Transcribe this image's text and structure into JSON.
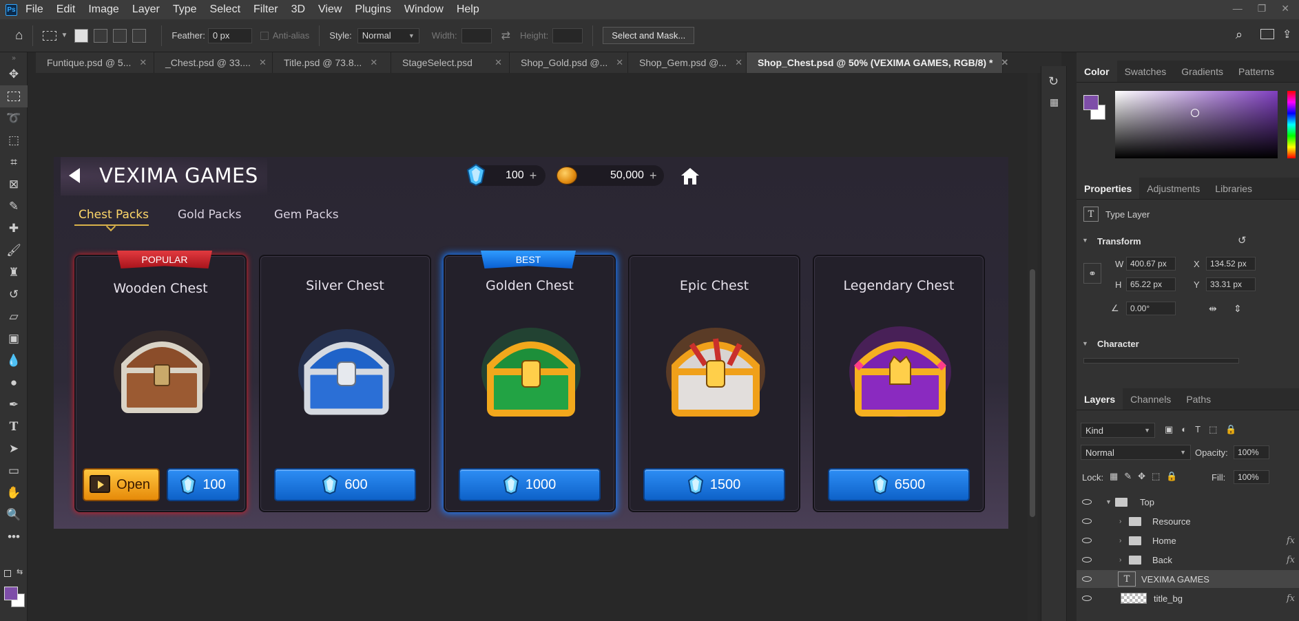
{
  "app": {
    "logo": "Ps",
    "menu": [
      "File",
      "Edit",
      "Image",
      "Layer",
      "Type",
      "Select",
      "Filter",
      "3D",
      "View",
      "Plugins",
      "Window",
      "Help"
    ]
  },
  "options": {
    "feather_label": "Feather:",
    "feather_value": "0 px",
    "anti_alias": "Anti-alias",
    "style_label": "Style:",
    "style_value": "Normal",
    "width_label": "Width:",
    "height_label": "Height:",
    "select_mask": "Select and Mask..."
  },
  "doc_tabs": [
    {
      "label": "Funtique.psd @ 5..."
    },
    {
      "label": "_Chest.psd @ 33...."
    },
    {
      "label": "Title.psd @ 73.8..."
    },
    {
      "label": "StageSelect.psd"
    },
    {
      "label": "Shop_Gold.psd @..."
    },
    {
      "label": "Shop_Gem.psd @..."
    },
    {
      "label": "Shop_Chest.psd @ 50% (VEXIMA GAMES, RGB/8) *"
    }
  ],
  "game": {
    "title": "VEXIMA GAMES",
    "gems": "100",
    "gold": "50,000",
    "plus": "+",
    "tabs": [
      "Chest Packs",
      "Gold Packs",
      "Gem Packs"
    ],
    "active_tab": "Chest Packs",
    "open_label": "Open",
    "cards": [
      {
        "name": "Wooden Chest",
        "badge": "POPULAR",
        "price": "100",
        "has_open": true
      },
      {
        "name": "Silver Chest",
        "badge": "",
        "price": "600",
        "has_open": false
      },
      {
        "name": "Golden Chest",
        "badge": "BEST",
        "price": "1000",
        "has_open": false
      },
      {
        "name": "Epic Chest",
        "badge": "",
        "price": "1500",
        "has_open": false
      },
      {
        "name": "Legendary Chest",
        "badge": "",
        "price": "6500",
        "has_open": false
      }
    ]
  },
  "color_panel": {
    "tabs": [
      "Color",
      "Swatches",
      "Gradients",
      "Patterns"
    ],
    "foreground": "#7e4ea8",
    "background": "#ffffff"
  },
  "properties": {
    "tabs": [
      "Properties",
      "Adjustments",
      "Libraries"
    ],
    "type_label": "Type Layer",
    "transform_label": "Transform",
    "w_label": "W",
    "w": "400.67 px",
    "h_label": "H",
    "h": "65.22 px",
    "x_label": "X",
    "x": "134.52 px",
    "y_label": "Y",
    "y": "33.31 px",
    "angle": "0.00°",
    "character_label": "Character"
  },
  "layers_panel": {
    "tabs": [
      "Layers",
      "Channels",
      "Paths"
    ],
    "kind": "Kind",
    "blend": "Normal",
    "opacity_label": "Opacity:",
    "opacity": "100%",
    "lock_label": "Lock:",
    "fill_label": "Fill:",
    "fill": "100%",
    "fx": "fx",
    "layers": [
      {
        "name": "Top",
        "type": "group",
        "indent": 0,
        "fx": false,
        "expanded": true
      },
      {
        "name": "Resource",
        "type": "group",
        "indent": 1,
        "fx": false
      },
      {
        "name": "Home",
        "type": "group",
        "indent": 1,
        "fx": true
      },
      {
        "name": "Back",
        "type": "group",
        "indent": 1,
        "fx": true
      },
      {
        "name": "VEXIMA GAMES",
        "type": "text",
        "indent": 1,
        "fx": false,
        "selected": true
      },
      {
        "name": "title_bg",
        "type": "pixel",
        "indent": 1,
        "fx": true
      }
    ]
  }
}
